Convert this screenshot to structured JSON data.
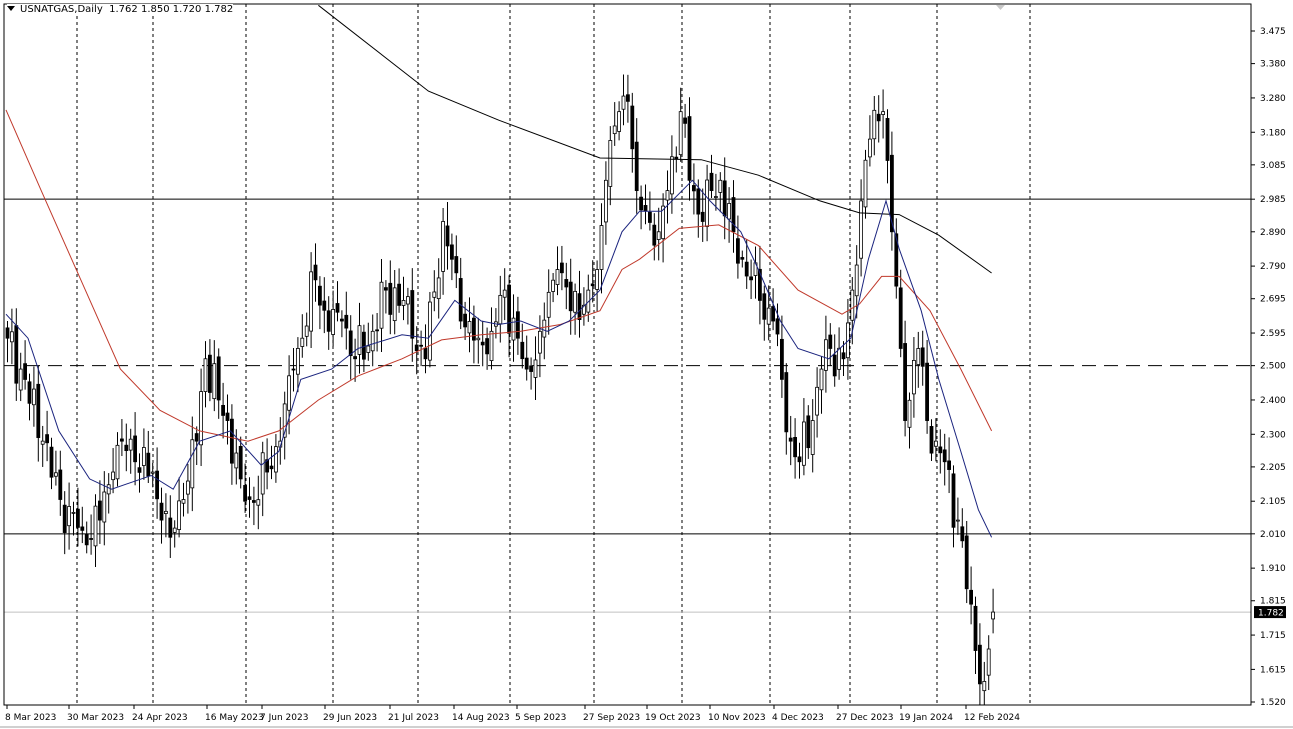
{
  "header": {
    "symbol": "USNATGAS",
    "timeframe": "Daily",
    "open": "1.762",
    "high": "1.850",
    "low": "1.720",
    "close": "1.782"
  },
  "colors": {
    "bull_body": "#ffffff",
    "bear_body": "#000000",
    "ma_fast": "#1a237e",
    "ma_slow": "#c0392b",
    "ma_long": "#000000",
    "current_price_line": "#c0c0c0"
  },
  "chart_data": {
    "type": "candlestick",
    "title": "USNATGAS, Daily",
    "ylim": [
      1.52,
      3.475
    ],
    "y_ticks": [
      "3.475",
      "3.380",
      "3.280",
      "3.180",
      "3.085",
      "2.985",
      "2.890",
      "2.790",
      "2.695",
      "2.595",
      "2.500",
      "2.400",
      "2.300",
      "2.205",
      "2.105",
      "2.010",
      "1.910",
      "1.815",
      "1.715",
      "1.615",
      "1.520"
    ],
    "x_ticks": [
      "8 Mar 2023",
      "30 Mar 2023",
      "24 Apr 2023",
      "16 May 2023",
      "7 Jun 2023",
      "29 Jun 2023",
      "21 Jul 2023",
      "14 Aug 2023",
      "5 Sep 2023",
      "27 Sep 2023",
      "19 Oct 2023",
      "10 Nov 2023",
      "4 Dec 2023",
      "27 Dec 2023",
      "19 Jan 2024",
      "12 Feb 2024"
    ],
    "bar_count": 225,
    "close_keypoints": [
      [
        0,
        2.58
      ],
      [
        3,
        2.49
      ],
      [
        8,
        2.28
      ],
      [
        12,
        2.11
      ],
      [
        17,
        2.02
      ],
      [
        21,
        2.05
      ],
      [
        24,
        2.19
      ],
      [
        26,
        2.28
      ],
      [
        29,
        2.22
      ],
      [
        33,
        2.19
      ],
      [
        35,
        2.05
      ],
      [
        37,
        2.0
      ],
      [
        40,
        2.11
      ],
      [
        43,
        2.28
      ],
      [
        45,
        2.52
      ],
      [
        48,
        2.4
      ],
      [
        50,
        2.34
      ],
      [
        53,
        2.17
      ],
      [
        55,
        2.11
      ],
      [
        59,
        2.19
      ],
      [
        62,
        2.28
      ],
      [
        65,
        2.49
      ],
      [
        67,
        2.58
      ],
      [
        70,
        2.75
      ],
      [
        73,
        2.6
      ],
      [
        76,
        2.63
      ],
      [
        79,
        2.52
      ],
      [
        83,
        2.6
      ],
      [
        86,
        2.72
      ],
      [
        90,
        2.69
      ],
      [
        92,
        2.58
      ],
      [
        95,
        2.52
      ],
      [
        99,
        2.92
      ],
      [
        101,
        2.81
      ],
      [
        103,
        2.63
      ],
      [
        107,
        2.58
      ],
      [
        110,
        2.6
      ],
      [
        113,
        2.72
      ],
      [
        116,
        2.58
      ],
      [
        118,
        2.49
      ],
      [
        121,
        2.6
      ],
      [
        125,
        2.78
      ],
      [
        128,
        2.66
      ],
      [
        132,
        2.72
      ],
      [
        134,
        2.78
      ],
      [
        136,
        3.04
      ],
      [
        139,
        3.24
      ],
      [
        141,
        3.27
      ],
      [
        143,
        3.01
      ],
      [
        145,
        2.95
      ],
      [
        148,
        2.89
      ],
      [
        150,
        3.01
      ],
      [
        153,
        3.24
      ],
      [
        155,
        3.04
      ],
      [
        158,
        2.92
      ],
      [
        160,
        3.01
      ],
      [
        162,
        3.04
      ],
      [
        165,
        2.89
      ],
      [
        167,
        2.81
      ],
      [
        169,
        2.75
      ],
      [
        171,
        2.69
      ],
      [
        174,
        2.63
      ],
      [
        176,
        2.46
      ],
      [
        178,
        2.28
      ],
      [
        180,
        2.22
      ],
      [
        183,
        2.34
      ],
      [
        185,
        2.49
      ],
      [
        187,
        2.55
      ],
      [
        190,
        2.52
      ],
      [
        192,
        2.72
      ],
      [
        194,
        2.98
      ],
      [
        196,
        3.16
      ],
      [
        199,
        3.24
      ],
      [
        201,
        2.89
      ],
      [
        203,
        2.55
      ],
      [
        204,
        2.34
      ],
      [
        207,
        2.55
      ],
      [
        209,
        2.34
      ],
      [
        211,
        2.28
      ],
      [
        213,
        2.22
      ],
      [
        216,
        2.05
      ],
      [
        218,
        1.85
      ],
      [
        220,
        1.67
      ],
      [
        222,
        1.58
      ],
      [
        224,
        1.782
      ]
    ],
    "last_bar": {
      "open": 1.762,
      "high": 1.85,
      "low": 1.72,
      "close": 1.782
    },
    "ma_fast": [
      [
        0,
        2.65
      ],
      [
        5,
        2.58
      ],
      [
        12,
        2.31
      ],
      [
        19,
        2.17
      ],
      [
        24,
        2.14
      ],
      [
        33,
        2.18
      ],
      [
        38,
        2.14
      ],
      [
        44,
        2.28
      ],
      [
        51,
        2.31
      ],
      [
        58,
        2.21
      ],
      [
        62,
        2.25
      ],
      [
        67,
        2.46
      ],
      [
        74,
        2.49
      ],
      [
        80,
        2.55
      ],
      [
        90,
        2.59
      ],
      [
        96,
        2.58
      ],
      [
        102,
        2.69
      ],
      [
        108,
        2.63
      ],
      [
        112,
        2.62
      ],
      [
        117,
        2.63
      ],
      [
        123,
        2.6
      ],
      [
        128,
        2.63
      ],
      [
        135,
        2.72
      ],
      [
        140,
        2.89
      ],
      [
        144,
        2.95
      ],
      [
        149,
        2.95
      ],
      [
        156,
        3.04
      ],
      [
        160,
        2.98
      ],
      [
        167,
        2.89
      ],
      [
        171,
        2.78
      ],
      [
        176,
        2.63
      ],
      [
        180,
        2.55
      ],
      [
        187,
        2.52
      ],
      [
        192,
        2.58
      ],
      [
        196,
        2.81
      ],
      [
        200,
        2.98
      ],
      [
        203,
        2.84
      ],
      [
        208,
        2.66
      ],
      [
        212,
        2.46
      ],
      [
        217,
        2.25
      ],
      [
        221,
        2.08
      ],
      [
        224,
        2.0
      ]
    ],
    "ma_slow": [
      [
        0,
        3.245
      ],
      [
        8,
        3.01
      ],
      [
        17,
        2.75
      ],
      [
        26,
        2.49
      ],
      [
        35,
        2.37
      ],
      [
        44,
        2.31
      ],
      [
        55,
        2.28
      ],
      [
        62,
        2.31
      ],
      [
        71,
        2.4
      ],
      [
        80,
        2.47
      ],
      [
        90,
        2.52
      ],
      [
        99,
        2.575
      ],
      [
        108,
        2.59
      ],
      [
        117,
        2.6
      ],
      [
        126,
        2.62
      ],
      [
        135,
        2.66
      ],
      [
        140,
        2.78
      ],
      [
        144,
        2.81
      ],
      [
        153,
        2.9
      ],
      [
        162,
        2.91
      ],
      [
        171,
        2.85
      ],
      [
        180,
        2.72
      ],
      [
        190,
        2.65
      ],
      [
        194,
        2.68
      ],
      [
        199,
        2.76
      ],
      [
        203,
        2.76
      ],
      [
        210,
        2.66
      ],
      [
        217,
        2.49
      ],
      [
        224,
        2.31
      ]
    ],
    "ma_long": [
      [
        71,
        3.55
      ],
      [
        96,
        3.3
      ],
      [
        112,
        3.215
      ],
      [
        135,
        3.105
      ],
      [
        158,
        3.1
      ],
      [
        171,
        3.055
      ],
      [
        185,
        2.98
      ],
      [
        194,
        2.945
      ],
      [
        203,
        2.94
      ],
      [
        212,
        2.88
      ],
      [
        224,
        2.77
      ]
    ],
    "horizontal_lines": [
      {
        "value": 2.985,
        "style": "solid"
      },
      {
        "value": 2.5,
        "style": "dashed"
      },
      {
        "value": 2.01,
        "style": "solid"
      }
    ],
    "current_price": "1.782",
    "grid": "vertical-dotted"
  }
}
